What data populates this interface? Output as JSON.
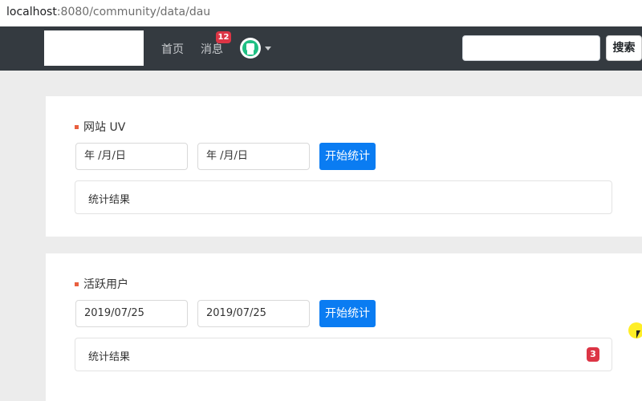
{
  "browser": {
    "url_host": "localhost",
    "url_rest": ":8080/community/data/dau"
  },
  "navbar": {
    "home_label": "首页",
    "messages_label": "消息",
    "messages_badge": "12",
    "search_placeholder": "",
    "search_button": "搜索"
  },
  "uv_section": {
    "title": "网站 UV",
    "start_date": "年 /月/日",
    "end_date": "年 /月/日",
    "button": "开始统计",
    "result_label": "统计结果"
  },
  "dau_section": {
    "title": "活跃用户",
    "start_date": "2019/07/25",
    "end_date": "2019/07/25",
    "button": "开始统计",
    "result_label": "统计结果",
    "result_value": "3"
  },
  "colors": {
    "navbar": "#343a40",
    "primary": "#0a7cf2",
    "badge": "#dc3545",
    "title_marker": "#e95f3f"
  }
}
